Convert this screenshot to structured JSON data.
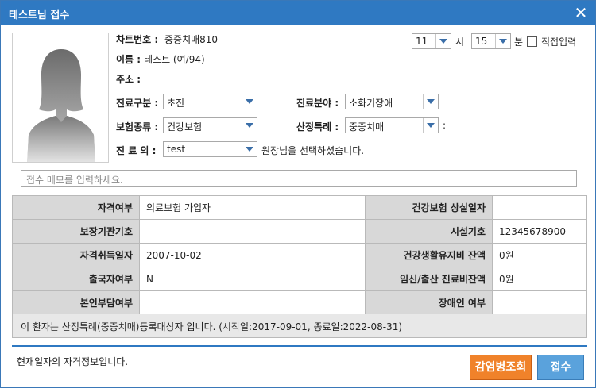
{
  "window": {
    "title": "테스트님 접수"
  },
  "patient": {
    "chart_label": "차트번호 :",
    "chart_value": "중증치매810",
    "name_label": "이름 :",
    "name_value": "테스트 (여/94)",
    "address_label": "주소 :",
    "address_value": ""
  },
  "time": {
    "hour_value": "11",
    "hour_unit": "시",
    "minute_value": "15",
    "minute_unit": "분",
    "direct_input_label": "직접입력",
    "direct_input_checked": false
  },
  "form": {
    "visit_type_label": "진료구분 :",
    "visit_type_value": "초진",
    "department_label": "진료분야 :",
    "department_value": "소화기장애",
    "insurance_label": "보험종류 :",
    "insurance_value": "건강보험",
    "special_case_label": "산정특례 :",
    "special_case_value": "중증치매",
    "special_case_suffix": ":",
    "doctor_label": "진 료 의 :",
    "doctor_value": "test",
    "doctor_message": "원장님을 선택하셨습니다."
  },
  "memo": {
    "placeholder": "접수 메모를 입력하세요."
  },
  "eligibility": {
    "rows": [
      {
        "label_left": "자격여부",
        "value_left": "의료보험 가입자",
        "label_right": "건강보험 상실일자",
        "value_right": ""
      },
      {
        "label_left": "보장기관기호",
        "value_left": "",
        "label_right": "시설기호",
        "value_right": "12345678900"
      },
      {
        "label_left": "자격취득일자",
        "value_left": "2007-10-02",
        "label_right": "건강생활유지비 잔액",
        "value_right": "0원"
      },
      {
        "label_left": "출국자여부",
        "value_left": "N",
        "label_right": "임신/출산 진료비잔액",
        "value_right": "0원"
      },
      {
        "label_left": "본인부담여부",
        "value_left": "",
        "label_right": "장애인 여부",
        "value_right": ""
      }
    ],
    "notice": "이 환자는 산정특례(중증치매)등록대상자 입니다. (시작일:2017-09-01, 종료일:2022-08-31)"
  },
  "footer": {
    "status_text": "현재일자의 자격정보입니다.",
    "lookup_button": "감염병조회",
    "submit_button": "접수"
  },
  "colors": {
    "titlebar": "#2f79c2",
    "lookup_button": "#f0822a",
    "submit_button": "#5aa2dc",
    "combo_arrow": "#3a6ea8"
  },
  "icons": {
    "close": "close-icon",
    "dropdown": "chevron-down-icon",
    "avatar": "person-silhouette-icon"
  }
}
